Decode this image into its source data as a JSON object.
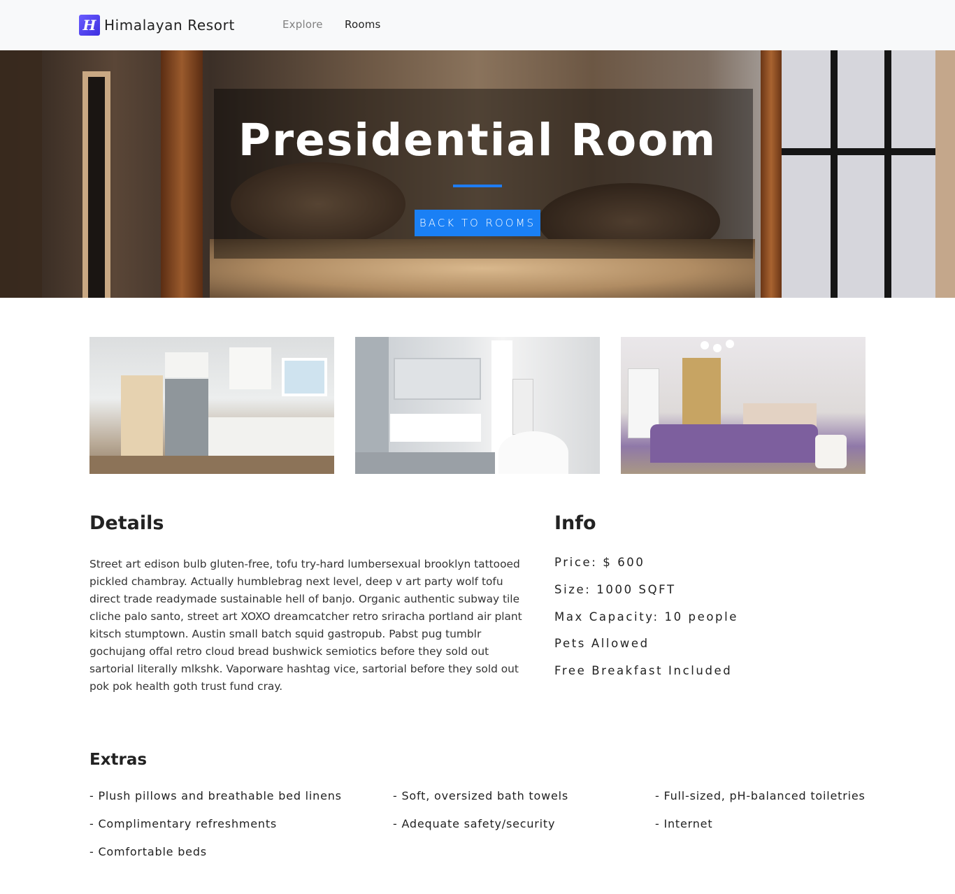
{
  "navbar": {
    "brand_name": "Himalayan Resort",
    "brand_logo_letter": "H",
    "links": [
      "Explore",
      "Rooms"
    ]
  },
  "hero": {
    "title": "Presidential Room",
    "button_label": "BACK TO ROOMS"
  },
  "gallery": {
    "images": [
      "kitchen",
      "bathroom",
      "bedroom"
    ]
  },
  "details": {
    "heading": "Details",
    "text": "Street art edison bulb gluten-free, tofu try-hard lumbersexual brooklyn tattooed pickled chambray. Actually humblebrag next level, deep v art party wolf tofu direct trade readymade sustainable hell of banjo. Organic authentic subway tile cliche palo santo, street art XOXO dreamcatcher retro sriracha portland air plant kitsch stumptown. Austin small batch squid gastropub. Pabst pug tumblr gochujang offal retro cloud bread bushwick semiotics before they sold out sartorial literally mlkshk. Vaporware hashtag vice, sartorial before they sold out pok pok health goth trust fund cray."
  },
  "info": {
    "heading": "Info",
    "lines": [
      "Price: $ 600",
      "Size: 1000 SQFT",
      "Max Capacity: 10 people",
      "Pets Allowed",
      "Free Breakfast Included"
    ]
  },
  "extras": {
    "heading": "Extras",
    "items": [
      "- Plush pillows and breathable bed linens",
      "- Soft, oversized bath towels",
      "- Full-sized, pH-balanced toiletries",
      "- Complimentary refreshments",
      "- Adequate safety/security",
      "- Internet",
      "- Comfortable beds"
    ]
  },
  "colors": {
    "accent": "#1a80f5",
    "navbar_bg": "#f8f9fa",
    "brand_logo": "#4f41f0"
  }
}
